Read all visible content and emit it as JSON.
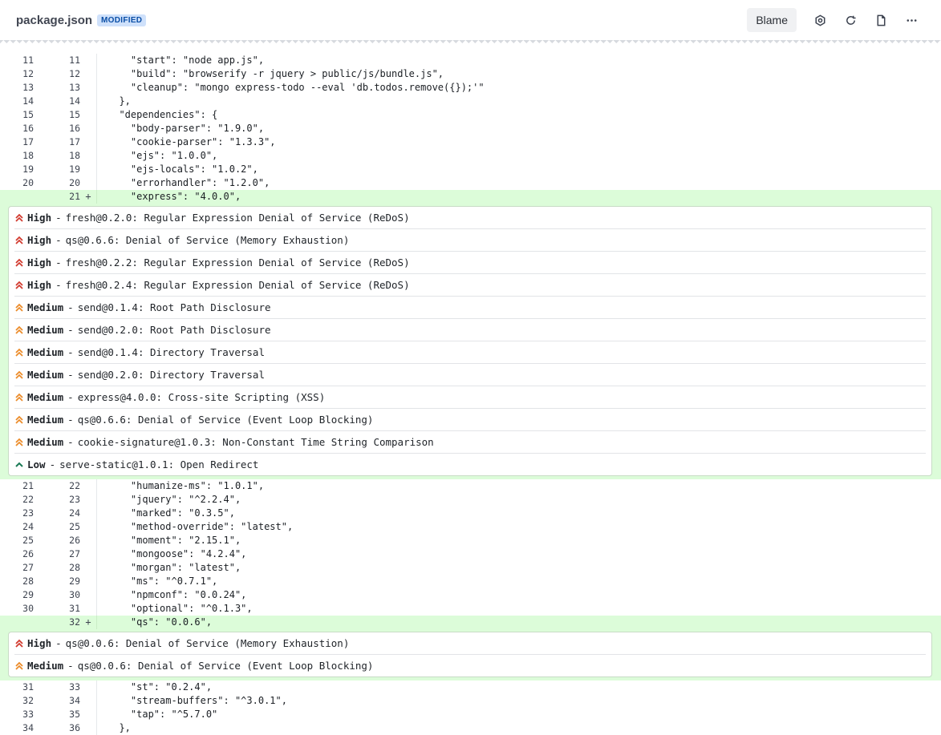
{
  "header": {
    "filename": "package.json",
    "badge": "MODIFIED",
    "blame": "Blame",
    "icons": [
      "settings-icon",
      "refresh-icon",
      "file-icon",
      "more-icon"
    ]
  },
  "colors": {
    "high": "#d23b2f",
    "medium": "#ec8c2a",
    "low": "#1b7a56",
    "added_bg": "#dcfcd9"
  },
  "blocks": [
    {
      "type": "code",
      "lines": [
        {
          "old": "11",
          "new": "11",
          "mark": "",
          "text": "    \"start\": \"node app.js\","
        },
        {
          "old": "12",
          "new": "12",
          "mark": "",
          "text": "    \"build\": \"browserify -r jquery > public/js/bundle.js\","
        },
        {
          "old": "13",
          "new": "13",
          "mark": "",
          "text": "    \"cleanup\": \"mongo express-todo --eval 'db.todos.remove({});'\""
        },
        {
          "old": "14",
          "new": "14",
          "mark": "",
          "text": "  },"
        },
        {
          "old": "15",
          "new": "15",
          "mark": "",
          "text": "  \"dependencies\": {"
        },
        {
          "old": "16",
          "new": "16",
          "mark": "",
          "text": "    \"body-parser\": \"1.9.0\","
        },
        {
          "old": "17",
          "new": "17",
          "mark": "",
          "text": "    \"cookie-parser\": \"1.3.3\","
        },
        {
          "old": "18",
          "new": "18",
          "mark": "",
          "text": "    \"ejs\": \"1.0.0\","
        },
        {
          "old": "19",
          "new": "19",
          "mark": "",
          "text": "    \"ejs-locals\": \"1.0.2\","
        },
        {
          "old": "20",
          "new": "20",
          "mark": "",
          "text": "    \"errorhandler\": \"1.2.0\","
        },
        {
          "old": "",
          "new": "21",
          "mark": "+",
          "text": "    \"express\": \"4.0.0\",",
          "added": true
        }
      ]
    },
    {
      "type": "vulns",
      "items": [
        {
          "severity": "High",
          "level": "high",
          "text": "fresh@0.2.0: Regular Expression Denial of Service (ReDoS)"
        },
        {
          "severity": "High",
          "level": "high",
          "text": "qs@0.6.6: Denial of Service (Memory Exhaustion)"
        },
        {
          "severity": "High",
          "level": "high",
          "text": "fresh@0.2.2: Regular Expression Denial of Service (ReDoS)"
        },
        {
          "severity": "High",
          "level": "high",
          "text": "fresh@0.2.4: Regular Expression Denial of Service (ReDoS)"
        },
        {
          "severity": "Medium",
          "level": "medium",
          "text": "send@0.1.4: Root Path Disclosure"
        },
        {
          "severity": "Medium",
          "level": "medium",
          "text": "send@0.2.0: Root Path Disclosure"
        },
        {
          "severity": "Medium",
          "level": "medium",
          "text": "send@0.1.4: Directory Traversal"
        },
        {
          "severity": "Medium",
          "level": "medium",
          "text": "send@0.2.0: Directory Traversal"
        },
        {
          "severity": "Medium",
          "level": "medium",
          "text": "express@4.0.0: Cross-site Scripting (XSS)"
        },
        {
          "severity": "Medium",
          "level": "medium",
          "text": "qs@0.6.6: Denial of Service (Event Loop Blocking)"
        },
        {
          "severity": "Medium",
          "level": "medium",
          "text": "cookie-signature@1.0.3: Non-Constant Time String Comparison"
        },
        {
          "severity": "Low",
          "level": "low",
          "text": "serve-static@1.0.1: Open Redirect"
        }
      ]
    },
    {
      "type": "code",
      "lines": [
        {
          "old": "21",
          "new": "22",
          "mark": "",
          "text": "    \"humanize-ms\": \"1.0.1\","
        },
        {
          "old": "22",
          "new": "23",
          "mark": "",
          "text": "    \"jquery\": \"^2.2.4\","
        },
        {
          "old": "23",
          "new": "24",
          "mark": "",
          "text": "    \"marked\": \"0.3.5\","
        },
        {
          "old": "24",
          "new": "25",
          "mark": "",
          "text": "    \"method-override\": \"latest\","
        },
        {
          "old": "25",
          "new": "26",
          "mark": "",
          "text": "    \"moment\": \"2.15.1\","
        },
        {
          "old": "26",
          "new": "27",
          "mark": "",
          "text": "    \"mongoose\": \"4.2.4\","
        },
        {
          "old": "27",
          "new": "28",
          "mark": "",
          "text": "    \"morgan\": \"latest\","
        },
        {
          "old": "28",
          "new": "29",
          "mark": "",
          "text": "    \"ms\": \"^0.7.1\","
        },
        {
          "old": "29",
          "new": "30",
          "mark": "",
          "text": "    \"npmconf\": \"0.0.24\","
        },
        {
          "old": "30",
          "new": "31",
          "mark": "",
          "text": "    \"optional\": \"^0.1.3\","
        },
        {
          "old": "",
          "new": "32",
          "mark": "+",
          "text": "    \"qs\": \"0.0.6\",",
          "added": true
        }
      ]
    },
    {
      "type": "vulns",
      "items": [
        {
          "severity": "High",
          "level": "high",
          "text": "qs@0.0.6: Denial of Service (Memory Exhaustion)"
        },
        {
          "severity": "Medium",
          "level": "medium",
          "text": "qs@0.0.6: Denial of Service (Event Loop Blocking)"
        }
      ]
    },
    {
      "type": "code",
      "lines": [
        {
          "old": "31",
          "new": "33",
          "mark": "",
          "text": "    \"st\": \"0.2.4\","
        },
        {
          "old": "32",
          "new": "34",
          "mark": "",
          "text": "    \"stream-buffers\": \"^3.0.1\","
        },
        {
          "old": "33",
          "new": "35",
          "mark": "",
          "text": "    \"tap\": \"^5.7.0\""
        },
        {
          "old": "34",
          "new": "36",
          "mark": "",
          "text": "  },"
        }
      ]
    }
  ]
}
